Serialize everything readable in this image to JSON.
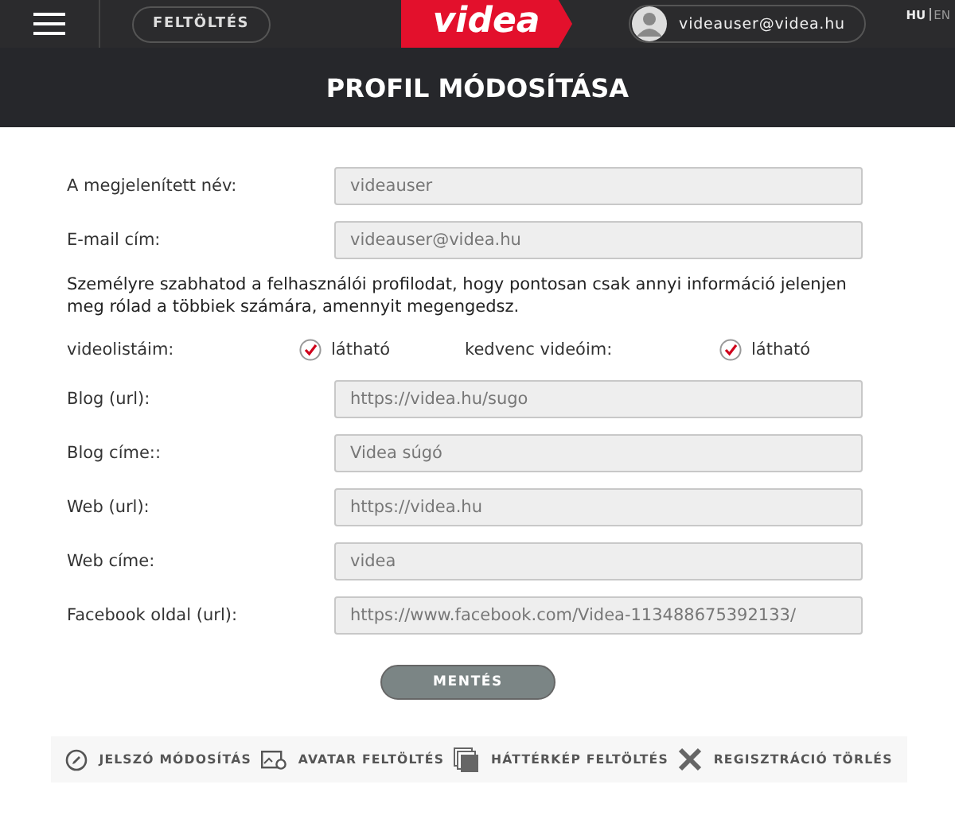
{
  "header": {
    "upload_button": "FELTÖLTÉS",
    "logo": "videa",
    "user": "videauser@videa.hu",
    "languages": [
      {
        "label": "HU",
        "selected": true
      },
      {
        "label": "EN",
        "selected": false
      }
    ]
  },
  "page_title": "PROFIL MÓDOSÍTÁSA",
  "rows": [
    {
      "kind": "field",
      "label": "A megjelenített név:",
      "value": "videauser"
    },
    {
      "kind": "field",
      "label": "E-mail cím:",
      "value": "videauser@videa.hu"
    },
    {
      "kind": "note",
      "text": "Személyre szabhatod a felhasználói profilodat, hogy pontosan csak annyi információ jelenjen meg rólad a többiek számára, amennyit megengedsz."
    },
    {
      "kind": "checks",
      "items": [
        {
          "label": "videolistáim:",
          "option": "látható",
          "checked": true
        },
        {
          "label": "kedvenc videóim:",
          "option": "látható",
          "checked": true
        }
      ]
    },
    {
      "kind": "field",
      "label": "Blog (url):",
      "value": "https://videa.hu/sugo"
    },
    {
      "kind": "field",
      "label": "Blog címe::",
      "value": "Videa súgó"
    },
    {
      "kind": "field",
      "label": "Web (url):",
      "value": "https://videa.hu"
    },
    {
      "kind": "field",
      "label": "Web címe:",
      "value": "videa"
    },
    {
      "kind": "field",
      "label": "Facebook oldal (url):",
      "value": "https://www.facebook.com/Videa-113488675392133/"
    }
  ],
  "save_button": "MENTÉS",
  "actions": [
    {
      "kind": "password",
      "label": "JELSZÓ MÓDOSÍTÁS"
    },
    {
      "kind": "avatar",
      "label": "AVATAR FELTÖLTÉS"
    },
    {
      "kind": "background",
      "label": "HÁTTÉRKÉP FELTÖLTÉS"
    },
    {
      "kind": "delete",
      "label": "REGISZTRÁCIÓ TÖRLÉS"
    }
  ]
}
